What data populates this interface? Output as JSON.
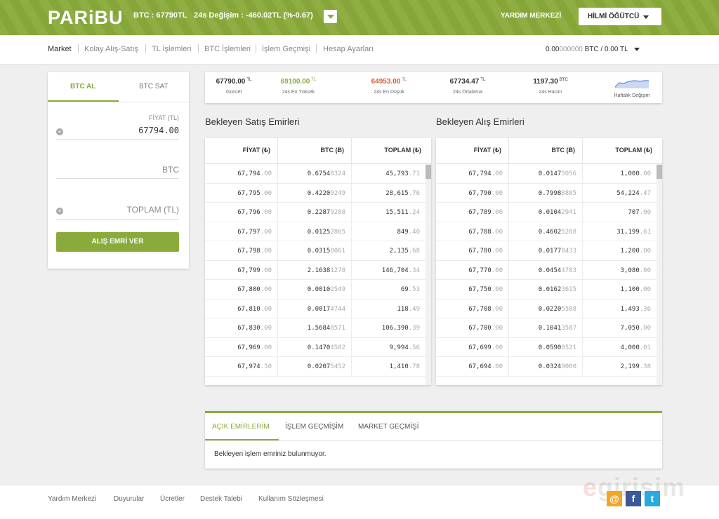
{
  "header": {
    "logo": "PARiBU",
    "ticker_btc": "BTC : 67790TL",
    "ticker_change": "24s Değişim : -460.02TL (%-0.67)",
    "help": "YARDIM MERKEZİ",
    "user": "HİLMİ ÖĞÜTCÜ"
  },
  "nav": {
    "items": [
      "Market",
      "Kolay Alış-Satış",
      "TL İşlemleri",
      "BTC İşlemleri",
      "İşlem Geçmişi",
      "Hesap Ayarları"
    ],
    "balance_main": "0.00",
    "balance_dim": "000000",
    "balance_rest": " BTC / 0.00 TL"
  },
  "form": {
    "tab_buy": "BTC AL",
    "tab_sell": "BTC SAT",
    "price_label": "FİYAT (TL)",
    "price_value": "67794.00",
    "btc_placeholder": "BTC",
    "total_placeholder": "TOPLAM (TL)",
    "submit": "ALIŞ EMRİ VER"
  },
  "stats": [
    {
      "value": "67790.00",
      "unit": "TL",
      "label": "Güncel",
      "color": "#333333"
    },
    {
      "value": "69100.00",
      "unit": "TL",
      "label": "24s En Yüksek",
      "color": "#8aab3b"
    },
    {
      "value": "64953.00",
      "unit": "TL",
      "label": "24s En Düşük",
      "color": "#e05a2b"
    },
    {
      "value": "67734.47",
      "unit": "TL",
      "label": "24s Ortalama",
      "color": "#333333"
    },
    {
      "value": "1197.30",
      "unit": "BTC",
      "label": "24s Hacim",
      "color": "#333333"
    }
  ],
  "weekly_label": "Haftalık Değişim",
  "sell": {
    "title": "Bekleyen Satış Emirleri",
    "headers": [
      "FİYAT (₺)",
      "BTC (Ƀ)",
      "TOPLAM (₺)"
    ],
    "rows": [
      [
        [
          "67,794",
          ".00"
        ],
        [
          "0.6754",
          "8324"
        ],
        [
          "45,793",
          ".71"
        ]
      ],
      [
        [
          "67,795",
          ".00"
        ],
        [
          "0.4220",
          "9249"
        ],
        [
          "28,615",
          ".76"
        ]
      ],
      [
        [
          "67,796",
          ".00"
        ],
        [
          "0.2287",
          "9288"
        ],
        [
          "15,511",
          ".24"
        ]
      ],
      [
        [
          "67,797",
          ".00"
        ],
        [
          "0.0125",
          "2865"
        ],
        [
          "849",
          ".40"
        ]
      ],
      [
        [
          "67,798",
          ".00"
        ],
        [
          "0.0315",
          "0061"
        ],
        [
          "2,135",
          ".68"
        ]
      ],
      [
        [
          "67,799",
          ".00"
        ],
        [
          "2.1638",
          "1278"
        ],
        [
          "146,704",
          ".34"
        ]
      ],
      [
        [
          "67,800",
          ".00"
        ],
        [
          "0.0010",
          "2549"
        ],
        [
          "69",
          ".53"
        ]
      ],
      [
        [
          "67,810",
          ".00"
        ],
        [
          "0.0017",
          "4744"
        ],
        [
          "118",
          ".49"
        ]
      ],
      [
        [
          "67,830",
          ".00"
        ],
        [
          "1.5684",
          "8571"
        ],
        [
          "106,390",
          ".39"
        ]
      ],
      [
        [
          "67,969",
          ".00"
        ],
        [
          "0.1470",
          "4582"
        ],
        [
          "9,994",
          ".56"
        ]
      ],
      [
        [
          "67,974",
          ".50"
        ],
        [
          "0.0207",
          "5452"
        ],
        [
          "1,410",
          ".78"
        ]
      ]
    ]
  },
  "buy": {
    "title": "Bekleyen Alış Emirleri",
    "headers": [
      "FİYAT (₺)",
      "BTC (Ƀ)",
      "TOPLAM (₺)"
    ],
    "rows": [
      [
        [
          "67,794",
          ".00"
        ],
        [
          "0.0147",
          "5056"
        ],
        [
          "1,000",
          ".00"
        ]
      ],
      [
        [
          "67,790",
          ".00"
        ],
        [
          "0.7998",
          "8885"
        ],
        [
          "54,224",
          ".47"
        ]
      ],
      [
        [
          "67,789",
          ".00"
        ],
        [
          "0.0104",
          "2941"
        ],
        [
          "707",
          ".00"
        ]
      ],
      [
        [
          "67,788",
          ".00"
        ],
        [
          "0.4602",
          "5268"
        ],
        [
          "31,199",
          ".61"
        ]
      ],
      [
        [
          "67,780",
          ".00"
        ],
        [
          "0.0177",
          "0433"
        ],
        [
          "1,200",
          ".00"
        ]
      ],
      [
        [
          "67,770",
          ".00"
        ],
        [
          "0.0454",
          "4783"
        ],
        [
          "3,080",
          ".00"
        ]
      ],
      [
        [
          "67,750",
          ".00"
        ],
        [
          "0.0162",
          "3615"
        ],
        [
          "1,100",
          ".00"
        ]
      ],
      [
        [
          "67,708",
          ".00"
        ],
        [
          "0.0220",
          "5588"
        ],
        [
          "1,493",
          ".36"
        ]
      ],
      [
        [
          "67,700",
          ".00"
        ],
        [
          "0.1041",
          "3587"
        ],
        [
          "7,050",
          ".00"
        ]
      ],
      [
        [
          "67,699",
          ".00"
        ],
        [
          "0.0590",
          "8521"
        ],
        [
          "4,000",
          ".01"
        ]
      ],
      [
        [
          "67,694",
          ".00"
        ],
        [
          "0.0324",
          "9000"
        ],
        [
          "2,199",
          ".38"
        ]
      ]
    ]
  },
  "orders": {
    "tabs": [
      "AÇIK EMİRLERİM",
      "İŞLEM GEÇMİŞİM",
      "MARKET GEÇMİŞİ"
    ],
    "empty": "Bekleyen işlem emriniz bulunmuyor."
  },
  "footer": {
    "links": [
      "Yardım Merkezi",
      "Duyurular",
      "Ücretler",
      "Destek Talebi",
      "Kullanım Sözleşmesi"
    ]
  },
  "watermark": {
    "e": "e",
    "rest": "girisim"
  },
  "social": {
    "mail": "@",
    "facebook": "f",
    "twitter": "t"
  },
  "colors": {
    "brand": "#8aab3b",
    "down": "#e05a2b",
    "mail": "#f2a623",
    "facebook": "#3b5998",
    "twitter": "#29a9e0"
  }
}
